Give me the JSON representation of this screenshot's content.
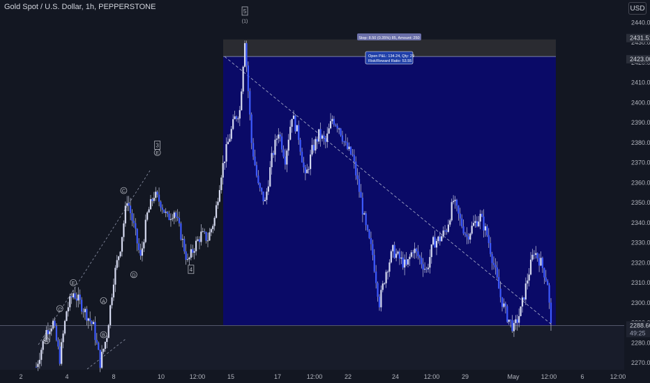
{
  "header": {
    "title": "Gold Spot / U.S. Dollar, 1h, PEPPERSTONE",
    "currency": "USD"
  },
  "position": {
    "stop_label": "Stop: 8.50 (0.35%) 85, Amount: 250",
    "open_label_1": "Open P&L: 134.24, Qty: 29",
    "open_label_2": "Risk/Reward Ratio: 53.55",
    "entry_price_tag": "2423.00",
    "stop_price_tag": "2431.51",
    "current_price_tag": "2288.66",
    "countdown_tag": "49:25"
  },
  "colors": {
    "background": "#131722",
    "candle": "#3d5afe",
    "wick": "#c7cbe0",
    "target_zone": "#0a0a6b",
    "stop_zone": "#2e2e33",
    "wave_label": "#b2b5be",
    "stop_label_bg": "#6a6fa8",
    "open_label_bg": "#1f3fa8"
  },
  "chart_data": {
    "type": "candlestick",
    "symbol": "Gold Spot / U.S. Dollar",
    "interval": "1h",
    "ylim": [
      2266,
      2446
    ],
    "y_ticks": [
      "2440.00",
      "2430.00",
      "2420.00",
      "2410.00",
      "2400.00",
      "2390.00",
      "2380.00",
      "2370.00",
      "2360.00",
      "2350.00",
      "2340.00",
      "2330.00",
      "2320.00",
      "2310.00",
      "2300.00",
      "2290.00",
      "2280.00",
      "2270.00"
    ],
    "x_ticks": [
      "2",
      "4",
      "8",
      "10",
      "12:00",
      "15",
      "17",
      "12:00",
      "22",
      "24",
      "12:00",
      "29",
      "May",
      "12:00",
      "6",
      "12:00"
    ],
    "price_path": [
      [
        0,
        2268
      ],
      [
        6,
        2286
      ],
      [
        10,
        2290
      ],
      [
        14,
        2272
      ],
      [
        18,
        2296
      ],
      [
        22,
        2305
      ],
      [
        26,
        2300
      ],
      [
        30,
        2294
      ],
      [
        34,
        2288
      ],
      [
        38,
        2270
      ],
      [
        42,
        2284
      ],
      [
        46,
        2312
      ],
      [
        50,
        2328
      ],
      [
        54,
        2352
      ],
      [
        58,
        2338
      ],
      [
        62,
        2322
      ],
      [
        66,
        2344
      ],
      [
        70,
        2354
      ],
      [
        74,
        2350
      ],
      [
        78,
        2342
      ],
      [
        82,
        2346
      ],
      [
        86,
        2334
      ],
      [
        90,
        2320
      ],
      [
        94,
        2328
      ],
      [
        98,
        2334
      ],
      [
        102,
        2332
      ],
      [
        106,
        2342
      ],
      [
        110,
        2365
      ],
      [
        114,
        2380
      ],
      [
        118,
        2392
      ],
      [
        121,
        2396
      ],
      [
        124,
        2432
      ],
      [
        128,
        2380
      ],
      [
        132,
        2358
      ],
      [
        136,
        2350
      ],
      [
        140,
        2372
      ],
      [
        144,
        2386
      ],
      [
        148,
        2372
      ],
      [
        152,
        2394
      ],
      [
        156,
        2383
      ],
      [
        160,
        2362
      ],
      [
        164,
        2376
      ],
      [
        168,
        2384
      ],
      [
        172,
        2380
      ],
      [
        176,
        2392
      ],
      [
        180,
        2388
      ],
      [
        184,
        2378
      ],
      [
        188,
        2373
      ],
      [
        192,
        2356
      ],
      [
        196,
        2337
      ],
      [
        200,
        2324
      ],
      [
        204,
        2300
      ],
      [
        208,
        2316
      ],
      [
        212,
        2326
      ],
      [
        216,
        2322
      ],
      [
        220,
        2318
      ],
      [
        224,
        2327
      ],
      [
        228,
        2322
      ],
      [
        232,
        2316
      ],
      [
        236,
        2330
      ],
      [
        240,
        2332
      ],
      [
        244,
        2337
      ],
      [
        248,
        2351
      ],
      [
        252,
        2341
      ],
      [
        256,
        2333
      ],
      [
        260,
        2339
      ],
      [
        264,
        2343
      ],
      [
        268,
        2334
      ],
      [
        272,
        2319
      ],
      [
        276,
        2303
      ],
      [
        280,
        2293
      ],
      [
        284,
        2287
      ],
      [
        288,
        2296
      ],
      [
        292,
        2312
      ],
      [
        296,
        2326
      ],
      [
        300,
        2320
      ],
      [
        304,
        2310
      ],
      [
        306,
        2288
      ]
    ],
    "elliott_waves": [
      {
        "label": "A",
        "time": 6,
        "price": 2280
      },
      {
        "label": "C",
        "time": 14,
        "price": 2296
      },
      {
        "label": "E",
        "time": 22,
        "price": 2309
      },
      {
        "label": "A",
        "time": 40,
        "price": 2300
      },
      {
        "label": "B",
        "time": 40,
        "price": 2283
      },
      {
        "label": "C",
        "time": 52,
        "price": 2355
      },
      {
        "label": "D",
        "time": 58,
        "price": 2313
      },
      {
        "label": "E",
        "time": 72,
        "price": 2374
      },
      {
        "label": "3",
        "time": 72,
        "price": 2378
      },
      {
        "label": "4",
        "time": 92,
        "price": 2316
      },
      {
        "label": "5",
        "time": 124,
        "price": 2445
      },
      {
        "label": "(1)",
        "time": 124,
        "price": 2440
      }
    ],
    "annotations": {
      "entry_price": 2423.0,
      "stop_price": 2431.51,
      "target_price": 2288.66
    }
  }
}
